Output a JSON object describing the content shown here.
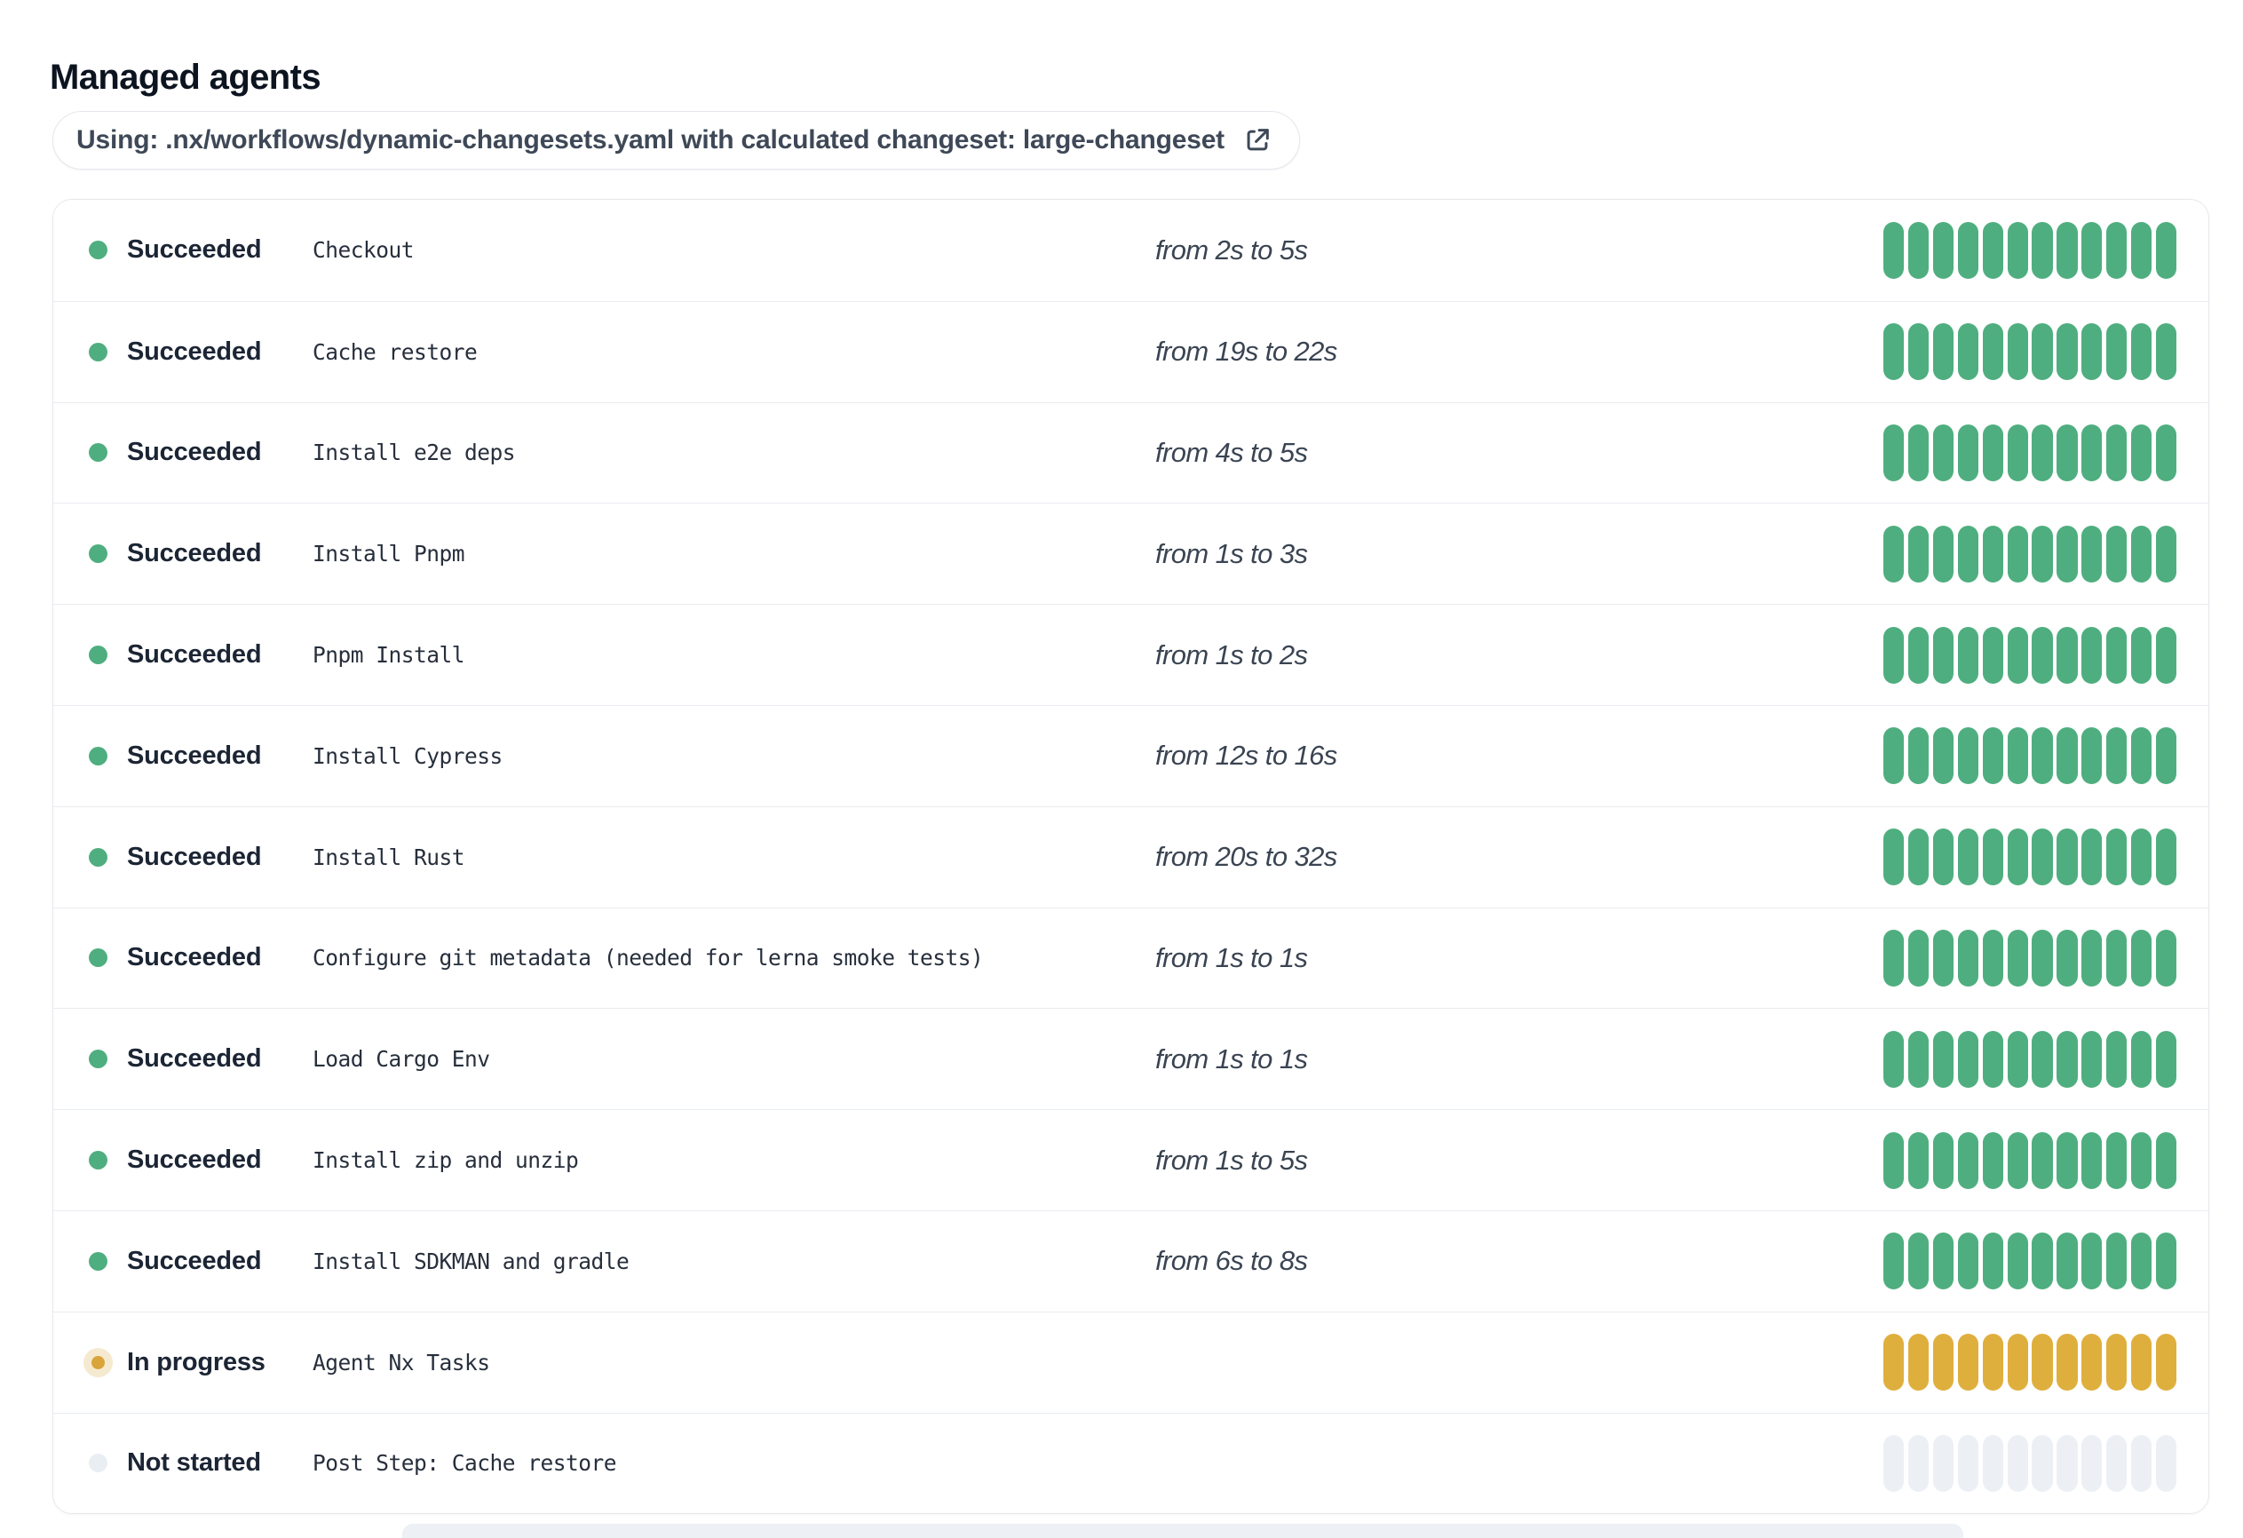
{
  "page": {
    "title": "Managed agents"
  },
  "workflow_banner": {
    "label": "Using: .nx/workflows/dynamic-changesets.yaml with calculated changeset: large-changeset",
    "icon": "external-link-icon"
  },
  "colors": {
    "succeeded": "#4fae7f",
    "in_progress_bar": "#dfaf3e",
    "in_progress_dot": "#d9a43c",
    "in_progress_halo": "#f5ead0",
    "not_started_segment": "#ecf0f5",
    "not_started_dot": "#e9eef3",
    "row_border": "#e9ecf0"
  },
  "agents": {
    "rows": [
      {
        "status": "succeeded",
        "status_label": "Succeeded",
        "name": "Checkout",
        "duration": "from 2s to 5s",
        "segments": 12
      },
      {
        "status": "succeeded",
        "status_label": "Succeeded",
        "name": "Cache restore",
        "duration": "from 19s to 22s",
        "segments": 12
      },
      {
        "status": "succeeded",
        "status_label": "Succeeded",
        "name": "Install e2e deps",
        "duration": "from 4s to 5s",
        "segments": 12
      },
      {
        "status": "succeeded",
        "status_label": "Succeeded",
        "name": "Install Pnpm",
        "duration": "from 1s to 3s",
        "segments": 12
      },
      {
        "status": "succeeded",
        "status_label": "Succeeded",
        "name": "Pnpm Install",
        "duration": "from 1s to 2s",
        "segments": 12
      },
      {
        "status": "succeeded",
        "status_label": "Succeeded",
        "name": "Install Cypress",
        "duration": "from 12s to 16s",
        "segments": 12
      },
      {
        "status": "succeeded",
        "status_label": "Succeeded",
        "name": "Install Rust",
        "duration": "from 20s to 32s",
        "segments": 12
      },
      {
        "status": "succeeded",
        "status_label": "Succeeded",
        "name": "Configure git metadata (needed for lerna smoke tests)",
        "duration": "from 1s to 1s",
        "segments": 12
      },
      {
        "status": "succeeded",
        "status_label": "Succeeded",
        "name": "Load Cargo Env",
        "duration": "from 1s to 1s",
        "segments": 12
      },
      {
        "status": "succeeded",
        "status_label": "Succeeded",
        "name": "Install zip and unzip",
        "duration": "from 1s to 5s",
        "segments": 12
      },
      {
        "status": "succeeded",
        "status_label": "Succeeded",
        "name": "Install SDKMAN and gradle",
        "duration": "from 6s to 8s",
        "segments": 12
      },
      {
        "status": "in_progress",
        "status_label": "In progress",
        "name": "Agent Nx Tasks",
        "duration": "",
        "segments": 12
      },
      {
        "status": "not_started",
        "status_label": "Not started",
        "name": "Post Step: Cache restore",
        "duration": "",
        "segments": 12
      }
    ]
  }
}
